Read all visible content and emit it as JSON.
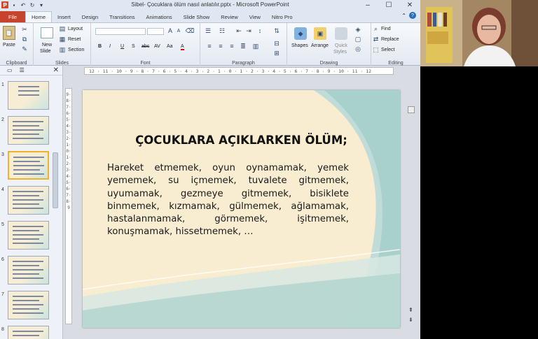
{
  "window": {
    "title": "Sibel- Çocuklara ölüm nasıl anlatılır.pptx  -  Microsoft PowerPoint",
    "minimize": "–",
    "maximize": "☐",
    "close": "✕"
  },
  "ribbon_tabs": [
    "File",
    "Home",
    "Insert",
    "Design",
    "Transitions",
    "Animations",
    "Slide Show",
    "Review",
    "View",
    "Nitro Pro"
  ],
  "ribbon": {
    "clipboard": {
      "paste": "Paste",
      "label": "Clipboard"
    },
    "slides": {
      "new_slide": "New",
      "new_slide2": "Slide",
      "layout": "Layout",
      "reset": "Reset",
      "section": "Section",
      "label": "Slides"
    },
    "font": {
      "bold": "B",
      "italic": "I",
      "underline": "U",
      "shadow": "S",
      "strike": "abc",
      "spacing": "AV",
      "case": "Aa",
      "color": "A",
      "label": "Font"
    },
    "paragraph": {
      "label": "Paragraph"
    },
    "drawing": {
      "shapes": "Shapes",
      "arrange": "Arrange",
      "quick_styles": "Quick",
      "quick_styles2": "Styles",
      "label": "Drawing"
    },
    "editing": {
      "find": "Find",
      "replace": "Replace",
      "select": "Select",
      "label": "Editing"
    }
  },
  "slides_panel": {
    "numbers": [
      "1",
      "2",
      "3",
      "4",
      "5",
      "6",
      "7",
      "8"
    ],
    "selected": 3
  },
  "ruler": {
    "horizontal": "12 · 11 · 10 · 9 · 8 · 7 · 6 · 5 · 4 · 3 · 2 · 1 · 0 · 1 · 2 · 3 · 4 · 5 · 6 · 7 · 8 · 9 · 10 · 11 · 12",
    "vertical": "9·8·7·6·5·4·3·2·1·0·1·2·3·4·5·6·7·8·9"
  },
  "slide": {
    "title": "ÇOCUKLARA AÇIKLARKEN ÖLÜM;",
    "body": "Hareket etmemek, oyun oynamamak, yemek yememek, su içmemek, tuvalete gitmemek, uyumamak,  gezmeye gitmemek, bisiklete binmemek,  kızmamak,  gülmemek, ağlamamak,  hastalanmamak,  görmemek, işitmemek, konuşmamak, hissetmemek, …"
  }
}
